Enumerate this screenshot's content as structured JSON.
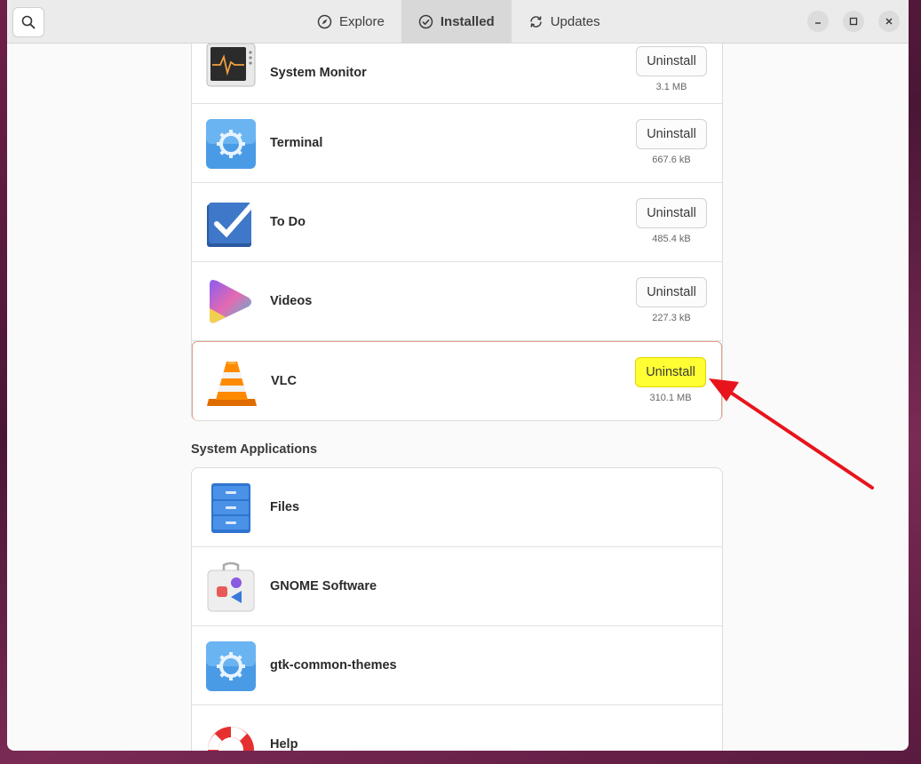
{
  "header": {
    "tabs": [
      {
        "label": "Explore",
        "icon": "compass-icon"
      },
      {
        "label": "Installed",
        "icon": "check-circle-icon"
      },
      {
        "label": "Updates",
        "icon": "refresh-icon"
      }
    ],
    "active_tab": "Installed"
  },
  "installed_apps": [
    {
      "name": "System Monitor",
      "button": "Uninstall",
      "size": "3.1 MB"
    },
    {
      "name": "Terminal",
      "button": "Uninstall",
      "size": "667.6 kB"
    },
    {
      "name": "To Do",
      "button": "Uninstall",
      "size": "485.4 kB"
    },
    {
      "name": "Videos",
      "button": "Uninstall",
      "size": "227.3 kB"
    },
    {
      "name": "VLC",
      "button": "Uninstall",
      "size": "310.1 MB"
    }
  ],
  "system_section": {
    "title": "System Applications",
    "apps": [
      {
        "name": "Files"
      },
      {
        "name": "GNOME Software"
      },
      {
        "name": "gtk-common-themes"
      },
      {
        "name": "Help"
      }
    ]
  },
  "colors": {
    "highlight": "#ffff33",
    "arrow": "#e8141c",
    "selected_border": "#e0a088"
  }
}
